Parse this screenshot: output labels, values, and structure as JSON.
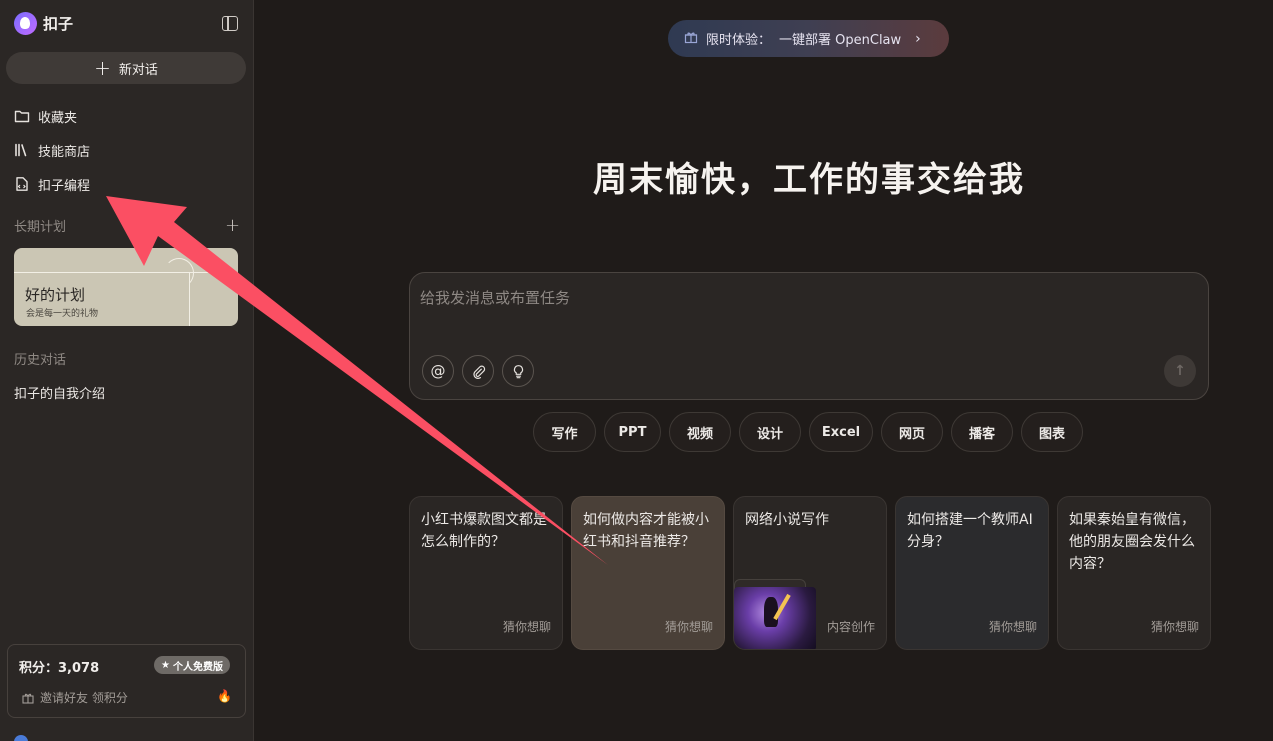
{
  "sidebar": {
    "brand": "扣子",
    "new_chat": "新对话",
    "nav": [
      "收藏夹",
      "技能商店",
      "扣子编程"
    ],
    "long_term_label": "长期计划",
    "plan_card": {
      "title": "好的计划",
      "subtitle": "会是每一天的礼物"
    },
    "history_label": "历史对话",
    "history_items": [
      "扣子的自我介绍"
    ],
    "points": {
      "label": "积分：3,078",
      "badge": "个人免费版",
      "invite": "邀请好友 领积分"
    }
  },
  "main": {
    "promo": {
      "prefix": "限时体验：",
      "text": "一键部署 OpenClaw"
    },
    "headline": "周末愉快，工作的事交给我",
    "composer": {
      "placeholder": "给我发消息或布置任务"
    },
    "chips": [
      "写作",
      "PPT",
      "视频",
      "设计",
      "Excel",
      "网页",
      "播客",
      "图表"
    ],
    "cards": [
      {
        "title": "小红书爆款图文都是怎么制作的？",
        "tag": "猜你想聊"
      },
      {
        "title": "如何做内容才能被小红书和抖音推荐？",
        "tag": "猜你想聊"
      },
      {
        "title": "网络小说写作",
        "tag": "内容创作"
      },
      {
        "title": "如何搭建一个教师AI分身？",
        "tag": "猜你想聊"
      },
      {
        "title": "如果秦始皇有微信，他的朋友圈会发什么内容？",
        "tag": "猜你想聊"
      }
    ]
  },
  "colors": {
    "arrow": "#fb4f63",
    "background": "#1f1b19",
    "sidebar": "#2b2725"
  },
  "icons": [
    "logo-icon",
    "sidebar-toggle-icon",
    "plus-icon",
    "folder-icon",
    "books-icon",
    "code-file-icon",
    "gift-icon",
    "chevron-right-icon",
    "at-icon",
    "paperclip-icon",
    "lightbulb-icon",
    "arrow-up-icon",
    "star-icon",
    "fire-icon"
  ]
}
